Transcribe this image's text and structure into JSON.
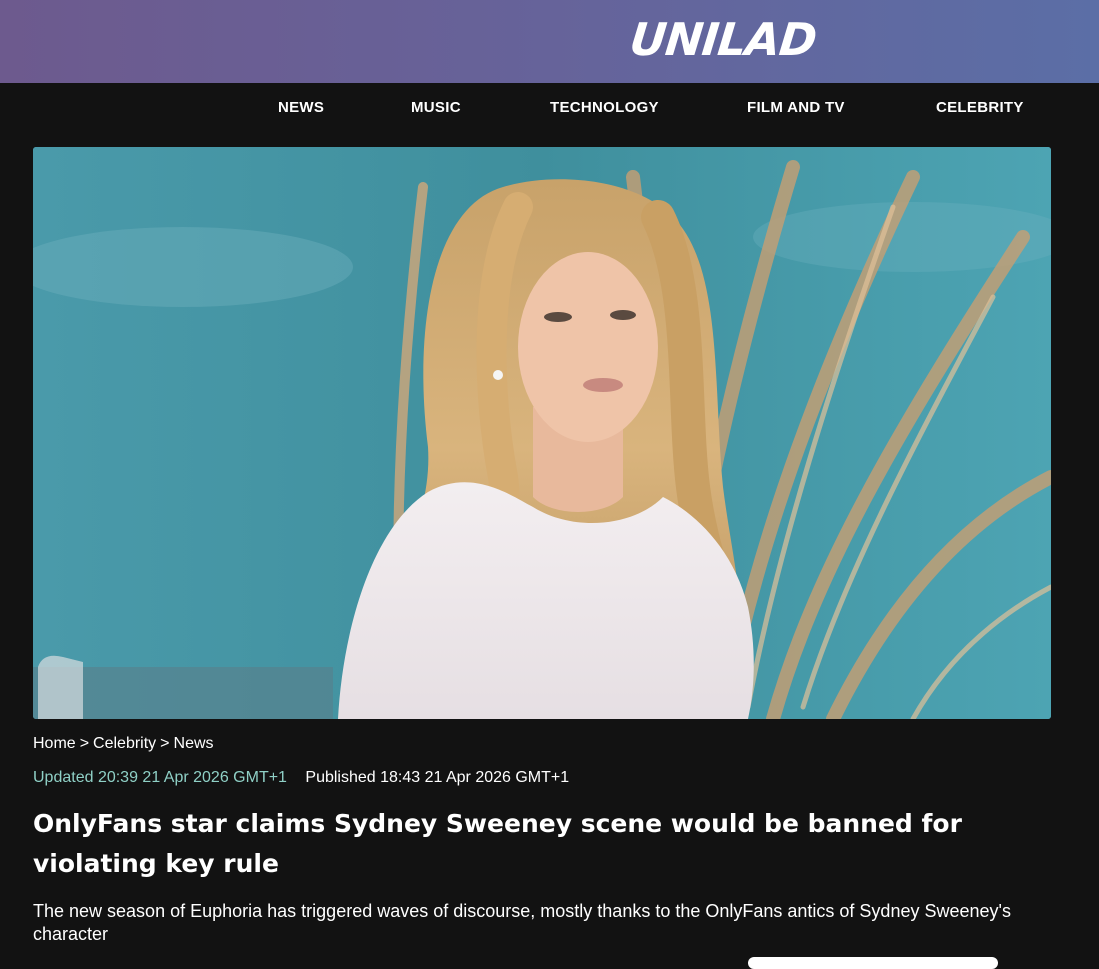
{
  "header": {
    "logo_text": "UNILAD"
  },
  "nav": {
    "items": [
      {
        "label": "NEWS"
      },
      {
        "label": "MUSIC"
      },
      {
        "label": "TECHNOLOGY"
      },
      {
        "label": "FILM AND TV"
      },
      {
        "label": "CELEBRITY"
      }
    ]
  },
  "hero": {
    "image_subject": "woman-with-long-blonde-hair-white-dress-teal-backdrop-pampas-grass"
  },
  "article": {
    "breadcrumb": [
      "Home",
      "Celebrity",
      "News"
    ],
    "breadcrumb_separator": ">",
    "updated": "Updated 20:39 21 Apr 2026 GMT+1",
    "published": "Published 18:43 21 Apr 2026 GMT+1",
    "headline": "OnlyFans star claims Sydney Sweeney scene would be banned for violating key rule",
    "standfirst": "The new season of Euphoria has triggered waves of discourse, mostly thanks to the OnlyFans antics of Sydney Sweeney's character"
  },
  "colors": {
    "header_gradient_start": "#6d5a8e",
    "header_gradient_end": "#5b6ea6",
    "page_background": "#121212",
    "updated_text": "#8fd0c6"
  }
}
